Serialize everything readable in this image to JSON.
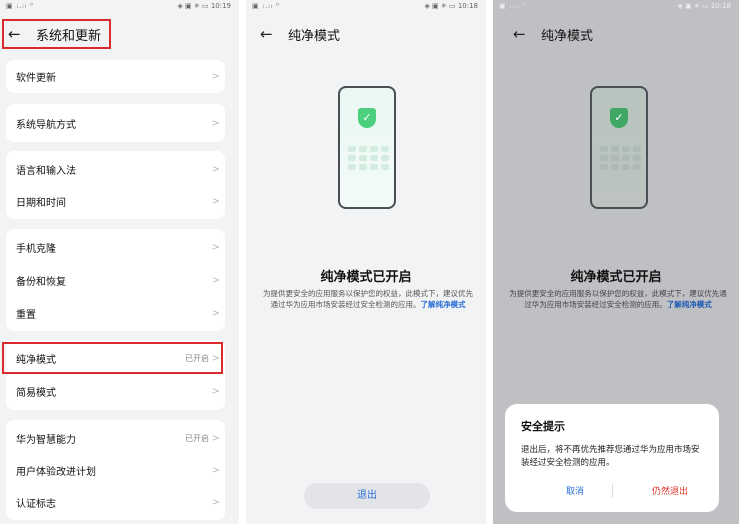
{
  "screen1": {
    "status_left": "▣ ᵢ.ᵢₗ ⁰",
    "status_right": "◈ ▣ ✳ ▭ 10:19",
    "title": "系统和更新",
    "groups": [
      [
        {
          "label": "软件更新"
        }
      ],
      [
        {
          "label": "系统导航方式"
        }
      ],
      [
        {
          "label": "语言和输入法"
        },
        {
          "label": "日期和时间"
        }
      ],
      [
        {
          "label": "手机克隆"
        },
        {
          "label": "备份和恢复"
        },
        {
          "label": "重置"
        }
      ],
      [
        {
          "label": "纯净模式",
          "value": "已开启"
        },
        {
          "label": "简易模式"
        }
      ],
      [
        {
          "label": "华为智慧能力",
          "value": "已开启"
        },
        {
          "label": "用户体验改进计划"
        },
        {
          "label": "认证标志"
        }
      ]
    ]
  },
  "screen2": {
    "status_left": "▣ ᵢ.ᵢₗ ⁰",
    "status_right": "◈ ▣ ✳ ▭ 10:18",
    "title": "纯净模式",
    "heading": "纯净模式已开启",
    "description": "为提供更安全的应用服务以保护您的权益，此模式下，建议优先通过华为应用市场安装经过安全检测的应用。",
    "link": "了解纯净模式",
    "exit_button": "退出"
  },
  "screen3": {
    "status_left": "▣ ᵢ.ᵢₗ ⁰",
    "status_right": "◈ ▣ ✳ ▭ 10:18",
    "title": "纯净模式",
    "heading": "纯净模式已开启",
    "description": "为提供更安全的应用服务以保护您的权益，此模式下，建议优先通过华为应用市场安装经过安全检测的应用。",
    "link": "了解纯净模式",
    "dialog": {
      "title": "安全提示",
      "body": "退出后，将不再优先推荐您通过华为应用市场安装经过安全检测的应用。",
      "cancel": "取消",
      "confirm": "仍然退出"
    }
  },
  "icons": {
    "back": "arrow-left",
    "chevron": "chevron-right",
    "shield": "shield-check"
  },
  "colors": {
    "highlight_red": "#d92b2b",
    "link_blue": "#2a6fd6",
    "danger_red": "#e0352b",
    "shield_green": "#4ccf7e"
  }
}
